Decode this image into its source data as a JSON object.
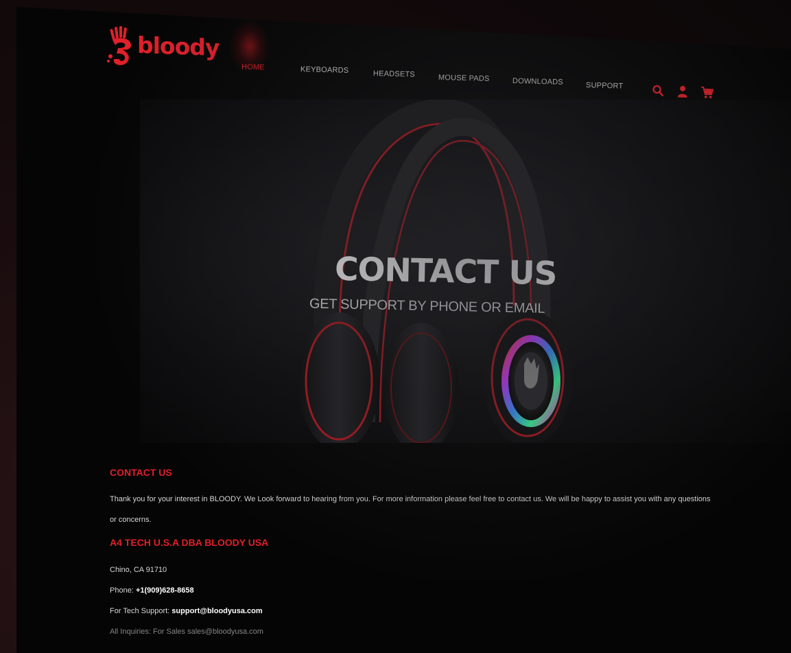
{
  "brand": {
    "name": "bloody",
    "accent_color": "#e0202a"
  },
  "nav": {
    "items": [
      {
        "label": "HOME",
        "active": true
      },
      {
        "label": "KEYBOARDS",
        "active": false
      },
      {
        "label": "HEADSETS",
        "active": false
      },
      {
        "label": "MOUSE PADS",
        "active": false
      },
      {
        "label": "DOWNLOADS",
        "active": false
      },
      {
        "label": "SUPPORT",
        "active": false
      }
    ]
  },
  "header_icons": [
    "search-icon",
    "user-icon",
    "cart-icon"
  ],
  "hero": {
    "title": "CONTACT US",
    "subtitle": "GET SUPPORT BY PHONE OR EMAIL"
  },
  "contact": {
    "heading": "CONTACT US",
    "intro": "Thank you for your interest in BLOODY. We Look forward to hearing from you. For more information please feel free to contact us. We will be happy to assist you with any questions or concerns.",
    "company": "A4 TECH U.S.A DBA BLOODY USA",
    "address": "Chino, CA 91710",
    "phone_label": "Phone:",
    "phone": "+1(909)628-8658",
    "tech_support_label": "For Tech Support:",
    "tech_support_email": "support@bloodyusa.com",
    "other_label": "All Inquiries: For Sales",
    "other_email": "sales@bloodyusa.com"
  }
}
